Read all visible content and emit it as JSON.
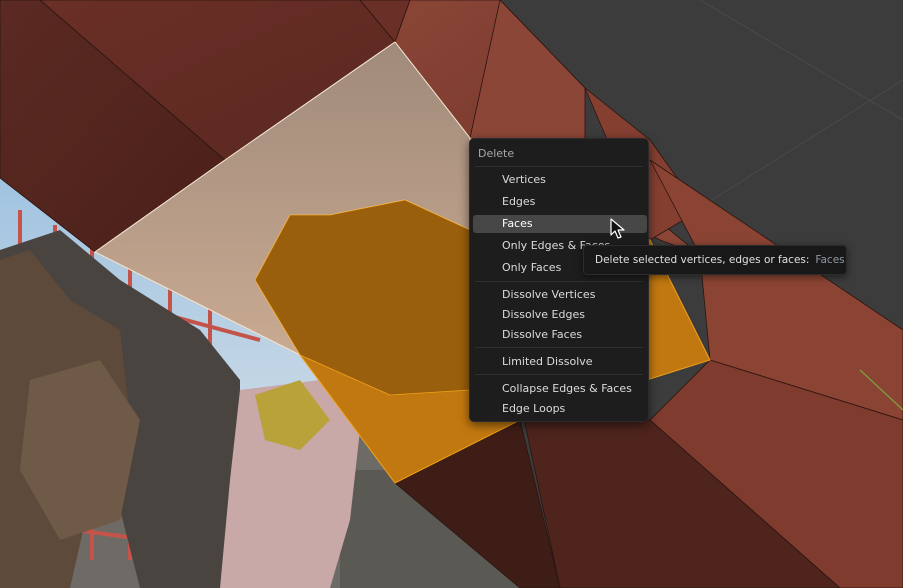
{
  "menu": {
    "title": "Delete",
    "items": [
      {
        "label": "Vertices"
      },
      {
        "label": "Edges"
      },
      {
        "label": "Faces",
        "active": true
      },
      {
        "label": "Only Edges & Faces"
      },
      {
        "label": "Only Faces"
      },
      {
        "label": "Dissolve Vertices"
      },
      {
        "label": "Dissolve Edges"
      },
      {
        "label": "Dissolve Faces"
      },
      {
        "label": "Limited Dissolve"
      },
      {
        "label": "Collapse Edges & Faces"
      },
      {
        "label": "Edge Loops"
      }
    ]
  },
  "tooltip": {
    "text": "Delete selected vertices, edges or faces:",
    "value": "Faces"
  },
  "icons": {
    "cursor": "arrow-cursor-icon"
  },
  "colors": {
    "viewport_bg": "#3c3c3c",
    "mesh_face": "#7a3a2e",
    "selected_face": "#c47a12",
    "active_face": "#9a7a6c",
    "menu_bg": "#1d1d1d",
    "menu_highlight": "#474747"
  }
}
